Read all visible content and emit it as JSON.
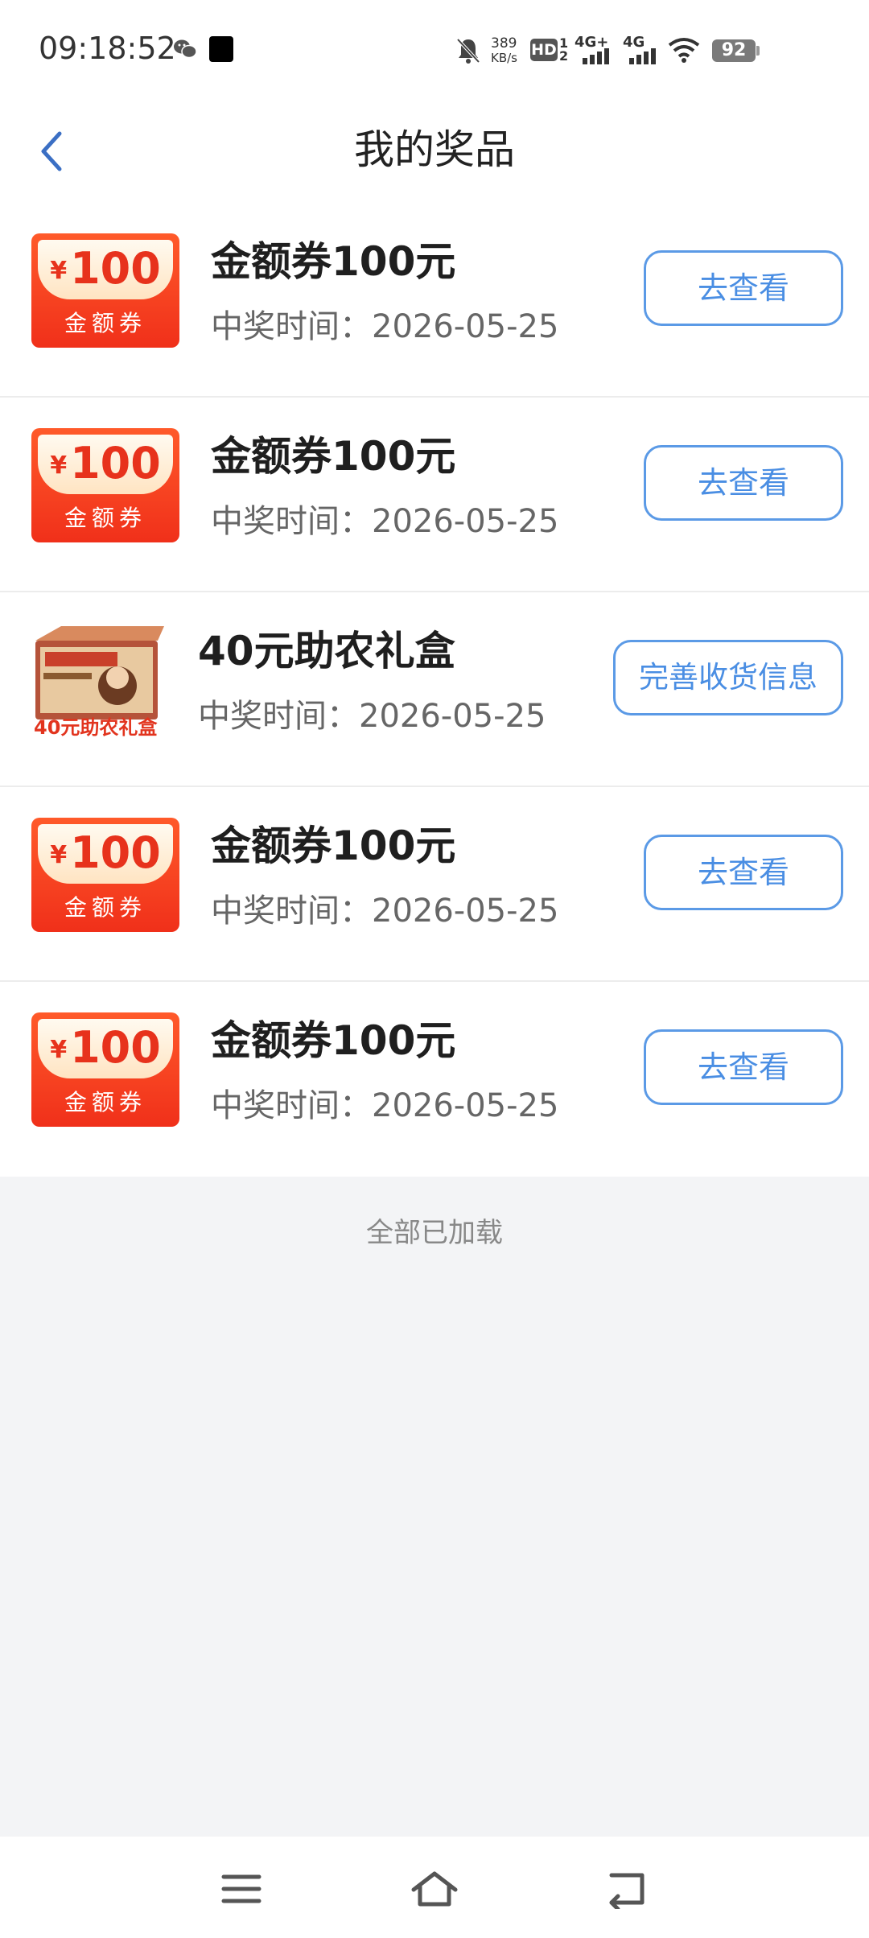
{
  "status_bar": {
    "time": "09:18:52",
    "net_speed_value": "389",
    "net_speed_unit": "KB/s",
    "hd_label": "HD",
    "hd_sub_top": "1",
    "hd_sub_bottom": "2",
    "signal1_label": "4G+",
    "signal2_label": "4G",
    "battery_level": "92",
    "icons": [
      "wechat-icon",
      "app-icon",
      "mute-bell-icon",
      "wifi-icon",
      "battery-icon"
    ]
  },
  "header": {
    "title": "我的奖品",
    "back_icon": "chevron-left-icon"
  },
  "coupon_art": {
    "currency": "¥",
    "amount": "100",
    "label": "金额券"
  },
  "giftbox_art": {
    "caption": "40元助农礼盒"
  },
  "prizes": [
    {
      "name": "金额券100元",
      "date": "中奖时间：2026-05-25",
      "action": "去查看",
      "kind": "coupon"
    },
    {
      "name": "金额券100元",
      "date": "中奖时间：2026-05-25",
      "action": "去查看",
      "kind": "coupon"
    },
    {
      "name": "40元助农礼盒",
      "date": "中奖时间：2026-05-25",
      "action": "完善收货信息",
      "kind": "giftbox"
    },
    {
      "name": "金额券100元",
      "date": "中奖时间：2026-05-25",
      "action": "去查看",
      "kind": "coupon"
    },
    {
      "name": "金额券100元",
      "date": "中奖时间：2026-05-25",
      "action": "去查看",
      "kind": "coupon"
    }
  ],
  "footer_note": "全部已加载",
  "nav_bar": {
    "icons": [
      "menu-icon",
      "home-icon",
      "back-icon"
    ]
  },
  "colors": {
    "accent": "#4a8ee3",
    "coupon_red": "#f0301a",
    "background": "#f3f4f6"
  }
}
